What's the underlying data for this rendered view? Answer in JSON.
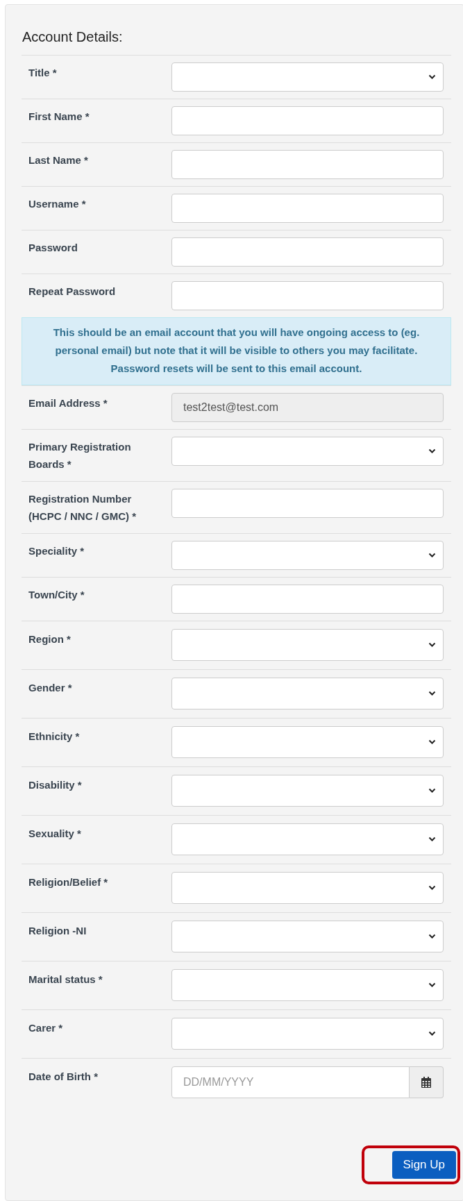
{
  "heading": "Account Details:",
  "fields": [
    {
      "kind": "select",
      "label": "Title *"
    },
    {
      "kind": "text",
      "label": "First Name *"
    },
    {
      "kind": "text",
      "label": "Last Name *"
    },
    {
      "kind": "text",
      "label": "Username *"
    },
    {
      "kind": "text",
      "label": "Password"
    },
    {
      "kind": "text",
      "label": "Repeat Password"
    },
    {
      "kind": "note",
      "text": "This should be an email account that you will have ongoing access to (eg. personal email) but note that it will be visible to others you may facilitate. Password resets will be sent to this email account."
    },
    {
      "kind": "text",
      "label": "Email Address *",
      "value": "test2test@test.com",
      "disabled": true
    },
    {
      "kind": "select",
      "label": "Primary Registration Boards  *"
    },
    {
      "kind": "text",
      "label": "Registration Number (HCPC / NNC / GMC) *"
    },
    {
      "kind": "select",
      "label": "Speciality  *"
    },
    {
      "kind": "text",
      "label": "Town/City *"
    },
    {
      "kind": "select",
      "label": "Region  *"
    },
    {
      "kind": "select",
      "label": "Gender *"
    },
    {
      "kind": "select",
      "label": "Ethnicity *"
    },
    {
      "kind": "select",
      "label": "Disability *"
    },
    {
      "kind": "select",
      "label": "Sexuality *"
    },
    {
      "kind": "select",
      "label": "Religion/Belief *"
    },
    {
      "kind": "select",
      "label": "Religion -NI"
    },
    {
      "kind": "select",
      "label": "Marital status *"
    },
    {
      "kind": "select",
      "label": "Carer *"
    },
    {
      "kind": "date",
      "label": "Date of Birth *",
      "placeholder": "DD/MM/YYYY"
    }
  ],
  "submit": {
    "label": "Sign Up",
    "highlighted": true
  }
}
